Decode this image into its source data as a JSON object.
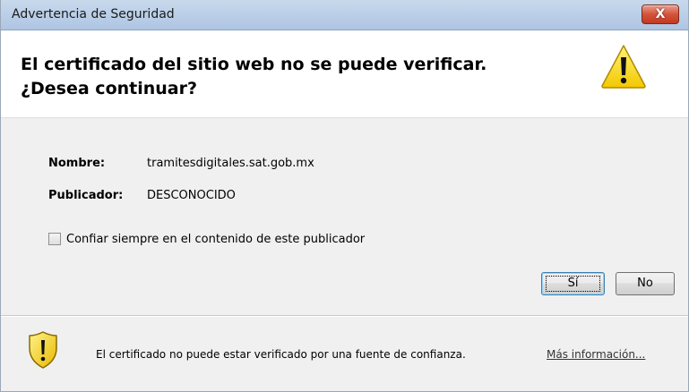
{
  "window": {
    "title": "Advertencia de Seguridad",
    "close_label": "X"
  },
  "header": {
    "message_line1": "El certificado del sitio web no se puede verificar.",
    "message_line2": "¿Desea continuar?",
    "icon": "warning-triangle-icon"
  },
  "details": {
    "name_label": "Nombre:",
    "name_value": "tramitesdigitales.sat.gob.mx",
    "publisher_label": "Publicador:",
    "publisher_value": "DESCONOCIDO"
  },
  "trust_checkbox": {
    "label_pre": "Conf",
    "label_accel": "i",
    "label_post": "ar siempre en el contenido de este publicador",
    "checked": false
  },
  "buttons": {
    "yes_label": "Sí",
    "no_label": "No"
  },
  "footer": {
    "icon": "shield-warning-icon",
    "message": "El certificado no puede estar verificado por una fuente de confianza.",
    "more_info_accel": "M",
    "more_info_rest": "ás información..."
  },
  "colors": {
    "titlebar": "#bcd0e8",
    "close_button": "#c23a20",
    "warning_yellow": "#f5d400",
    "dialog_background": "#f0f0f0",
    "header_background": "#ffffff",
    "default_button_border": "#3c7fb1"
  }
}
